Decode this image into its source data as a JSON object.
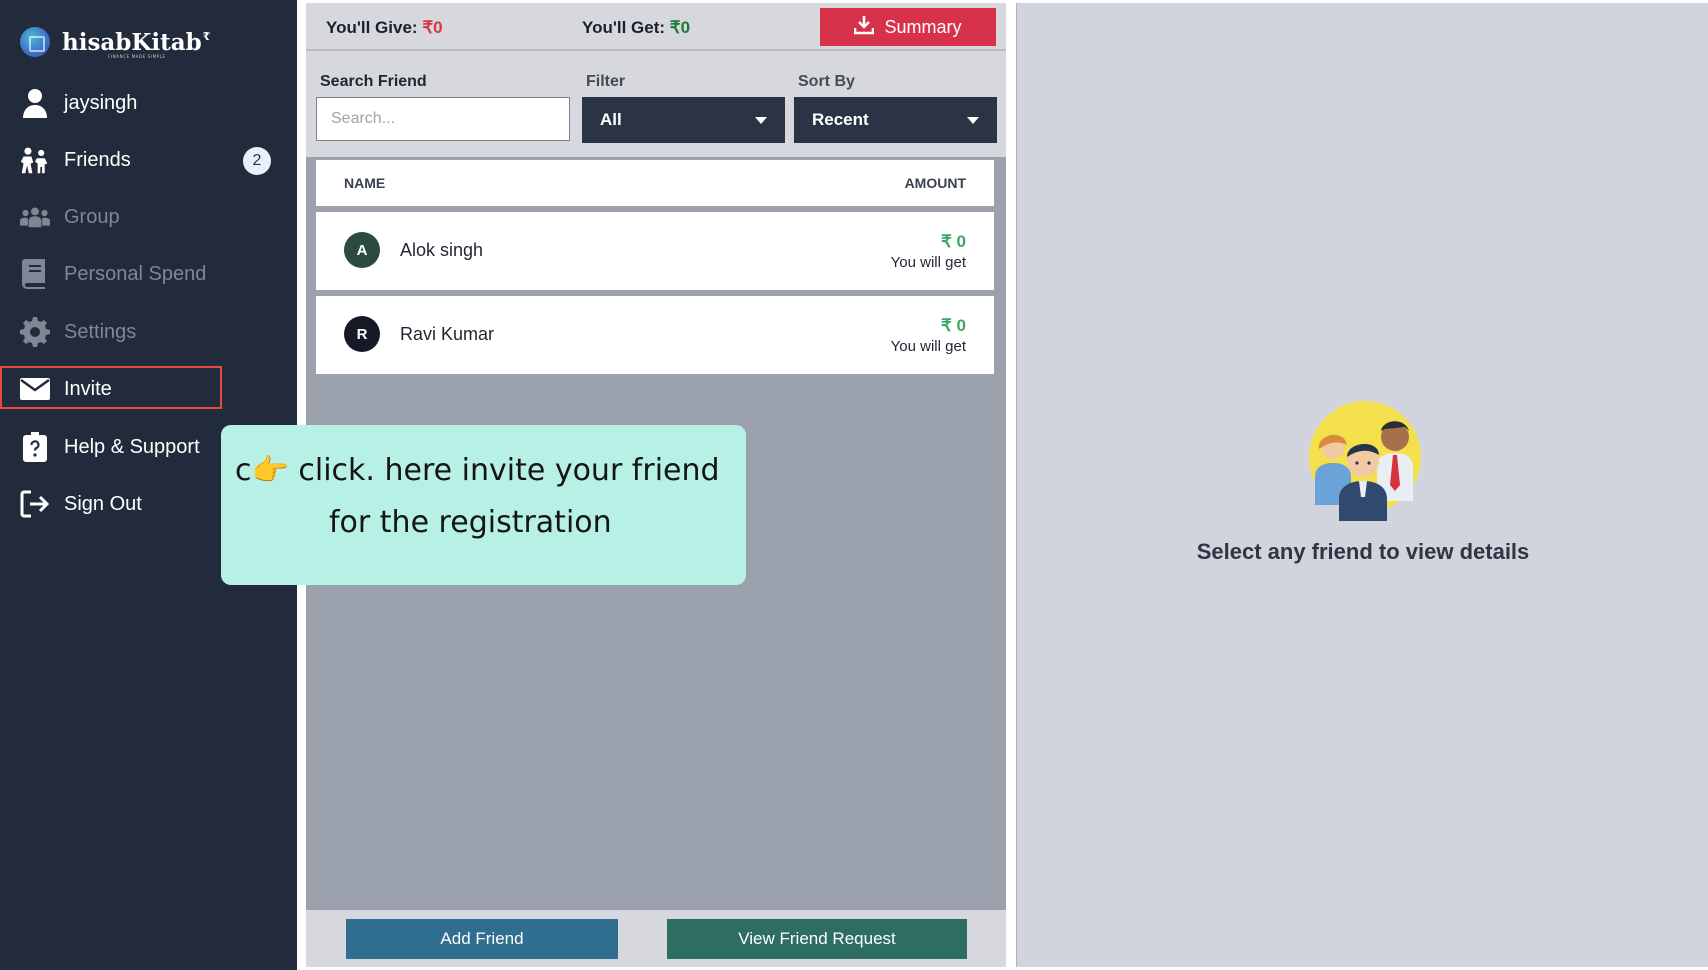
{
  "brand": {
    "name": "hisabKitab",
    "symbol": "₹",
    "tagline": "FINANCE MADE SIMPLE"
  },
  "sidebar": {
    "items": [
      {
        "label": "jaysingh",
        "icon": "user-icon"
      },
      {
        "label": "Friends",
        "icon": "friends-icon",
        "badge": "2"
      },
      {
        "label": "Group",
        "icon": "group-icon"
      },
      {
        "label": "Personal Spend",
        "icon": "book-icon"
      },
      {
        "label": "Settings",
        "icon": "gear-icon"
      },
      {
        "label": "Invite",
        "icon": "envelope-icon"
      },
      {
        "label": "Help & Support",
        "icon": "clipboard-question-icon"
      },
      {
        "label": "Sign Out",
        "icon": "sign-out-icon"
      }
    ]
  },
  "summary": {
    "give_label": "You'll Give:",
    "give_value": "₹0",
    "get_label": "You'll Get:",
    "get_value": "₹0",
    "summary_button": "Summary"
  },
  "filters": {
    "search_label": "Search Friend",
    "search_placeholder": "Search...",
    "filter_label": "Filter",
    "filter_value": "All",
    "sort_label": "Sort By",
    "sort_value": "Recent"
  },
  "table": {
    "headers": {
      "name": "NAME",
      "amount": "AMOUNT"
    },
    "rows": [
      {
        "initial": "A",
        "name": "Alok singh",
        "amount": "₹ 0",
        "note": "You will get",
        "avatar_color": "#2d4a3e"
      },
      {
        "initial": "R",
        "name": "Ravi Kumar",
        "amount": "₹ 0",
        "note": "You will get",
        "avatar_color": "#161a26"
      }
    ]
  },
  "actions": {
    "add_friend": "Add Friend",
    "view_requests": "View Friend Request"
  },
  "details": {
    "empty_text": "Select any friend to view details"
  },
  "callout": {
    "line1": "c👉 click. here invite your friend",
    "line2": "for the registration"
  },
  "colors": {
    "sidebar_bg": "#222b3c",
    "summary_button": "#d8324a",
    "give_value": "#d93447",
    "get_value": "#21793c",
    "add_friend_button": "#2f6e8f",
    "view_requests_button": "#2e6d62",
    "callout_bg": "#b7f1e5",
    "highlight_border": "#e44b3f"
  }
}
